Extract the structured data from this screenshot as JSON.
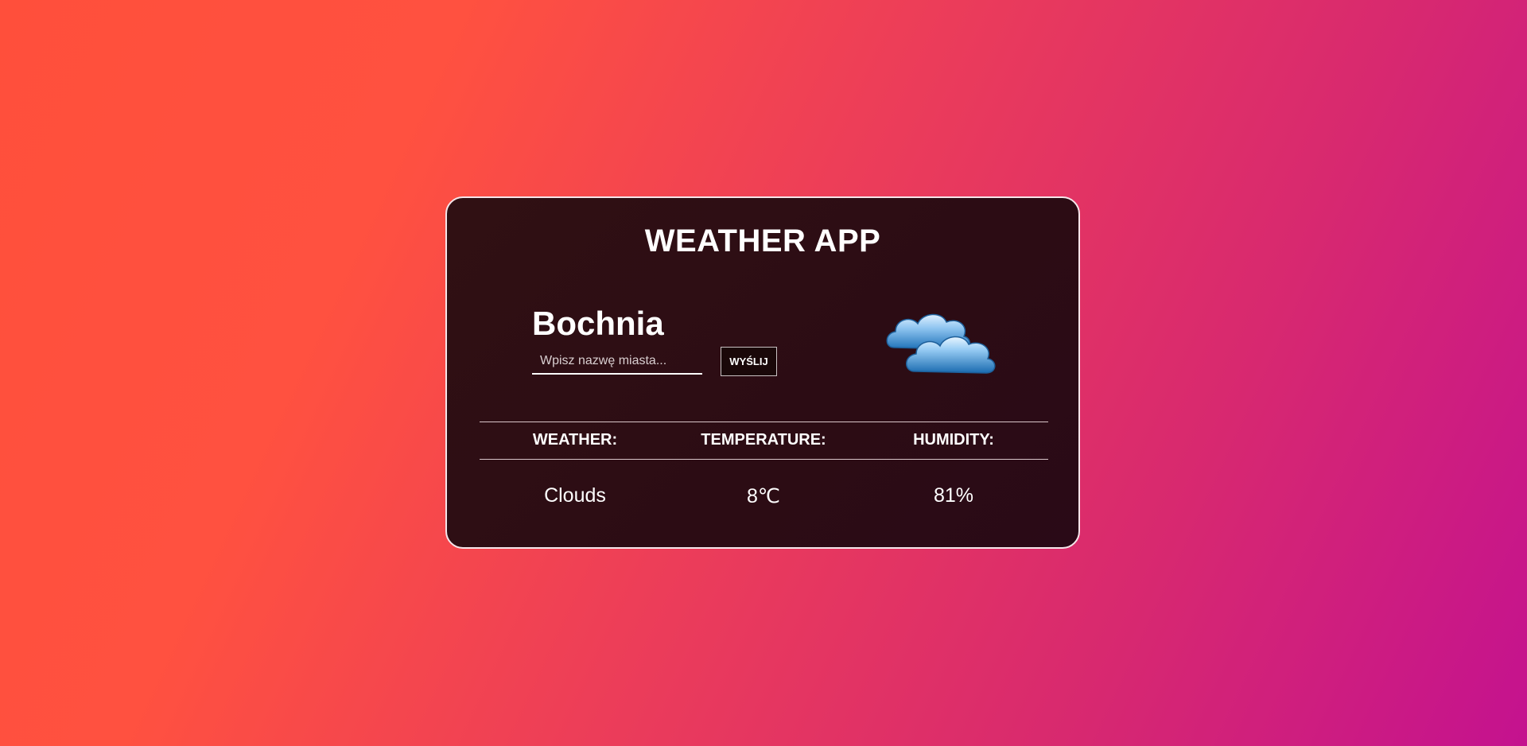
{
  "app": {
    "title": "WEATHER APP"
  },
  "location": {
    "city": "Bochnia"
  },
  "search": {
    "placeholder": "Wpisz nazwę miasta...",
    "value": "",
    "button_label": "WYŚLIJ"
  },
  "weather_icon": {
    "icon": "clouds-icon"
  },
  "table": {
    "headers": [
      "WEATHER:",
      "TEMPERATURE:",
      "HUMIDITY:"
    ],
    "values": {
      "weather": "Clouds",
      "temperature_value": "8",
      "temperature_unit": "℃",
      "humidity": "81%"
    }
  },
  "colors": {
    "card_background": "#2e0d15",
    "card_border": "#f5e6ea",
    "gradient_start": "#ff4f3b",
    "gradient_end": "#c4128f",
    "text": "#ffffff"
  }
}
